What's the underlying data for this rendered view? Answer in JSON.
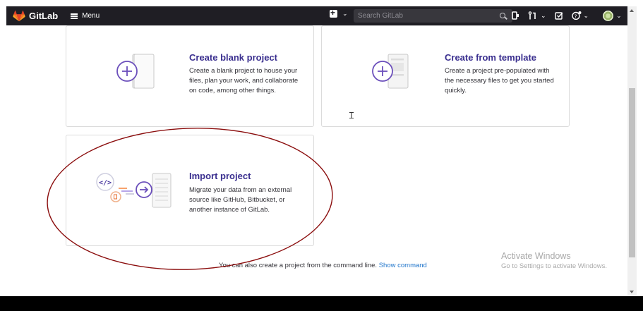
{
  "nav": {
    "brand": "GitLab",
    "menu_label": "Menu",
    "search_placeholder": "Search GitLab"
  },
  "cards": [
    {
      "title": "Create blank project",
      "description": "Create a blank project to house your files, plan your work, and collaborate on code, among other things."
    },
    {
      "title": "Create from template",
      "description": "Create a project pre-populated with the necessary files to get you started quickly."
    },
    {
      "title": "Import project",
      "description": "Migrate your data from an external source like GitHub, Bitbucket, or another instance of GitLab."
    }
  ],
  "footer": {
    "text": "You can also create a project from the command line.",
    "link": "Show command"
  },
  "watermark": {
    "line1": "Activate Windows",
    "line2": "Go to Settings to activate Windows."
  },
  "colors": {
    "navbar": "#1f1e24",
    "accent": "#6b4fbb",
    "title": "#3a2f8f",
    "link": "#1f75cb",
    "annotation": "#8b0d0d"
  }
}
